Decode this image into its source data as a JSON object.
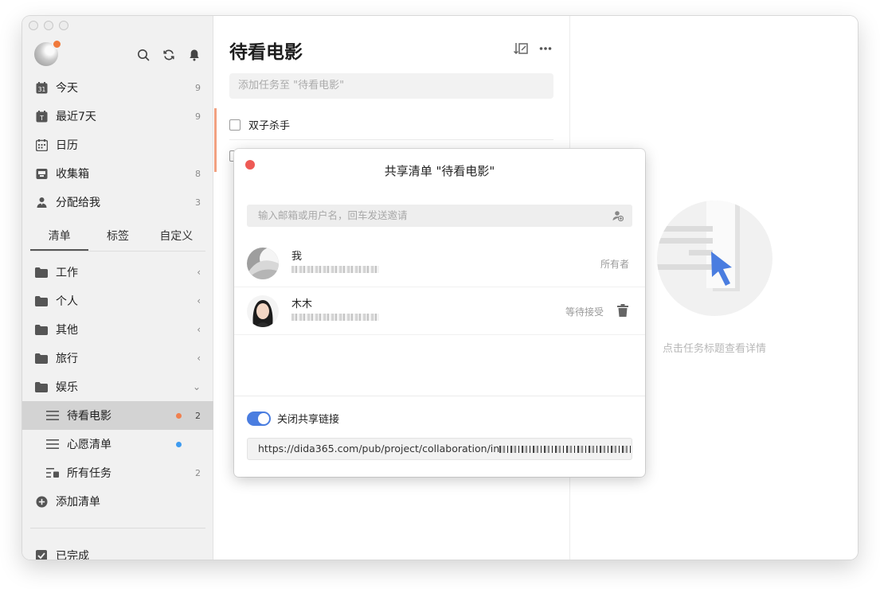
{
  "sidebar": {
    "nav": [
      {
        "label": "今天",
        "count": "9",
        "icon": "calendar-today-icon"
      },
      {
        "label": "最近7天",
        "count": "9",
        "icon": "calendar-week-icon"
      },
      {
        "label": "日历",
        "count": "",
        "icon": "calendar-icon"
      },
      {
        "label": "收集箱",
        "count": "8",
        "icon": "inbox-icon"
      },
      {
        "label": "分配给我",
        "count": "3",
        "icon": "person-icon"
      }
    ],
    "today_day": "31",
    "week_letter": "T",
    "tabs": [
      "清单",
      "标签",
      "自定义"
    ],
    "lists": [
      {
        "label": "工作",
        "icon": "folder-icon"
      },
      {
        "label": "个人",
        "icon": "folder-icon"
      },
      {
        "label": "其他",
        "icon": "folder-icon"
      },
      {
        "label": "旅行",
        "icon": "folder-icon"
      },
      {
        "label": "娱乐",
        "icon": "folder-icon"
      }
    ],
    "sub_lists": [
      {
        "label": "待看电影",
        "count": "2",
        "dot_color": "#f0804f"
      },
      {
        "label": "心愿清单",
        "count": "",
        "dot_color": "#3e9bf0"
      },
      {
        "label": "所有任务",
        "count": "2",
        "dot_color": ""
      }
    ],
    "add_list": "添加清单",
    "completed": "已完成"
  },
  "main": {
    "title": "待看电影",
    "add_placeholder": "添加任务至 \"待看电影\"",
    "tasks": [
      "双子杀手"
    ]
  },
  "detail": {
    "empty_text": "点击任务标题查看详情"
  },
  "share_dialog": {
    "title": "共享清单 \"待看电影\"",
    "invite_placeholder": "输入邮箱或用户名，回车发送邀请",
    "members": [
      {
        "name": "我",
        "role": "所有者"
      },
      {
        "name": "木木",
        "role": "等待接受"
      }
    ],
    "toggle_label": "关闭共享链接",
    "toggle_on": true,
    "link_prefix": "https://dida365.com/pub/project/collaboration/in"
  },
  "colors": {
    "accent": "#4a7de0",
    "close_red": "#ee5a55",
    "priority": "#f1a080"
  }
}
